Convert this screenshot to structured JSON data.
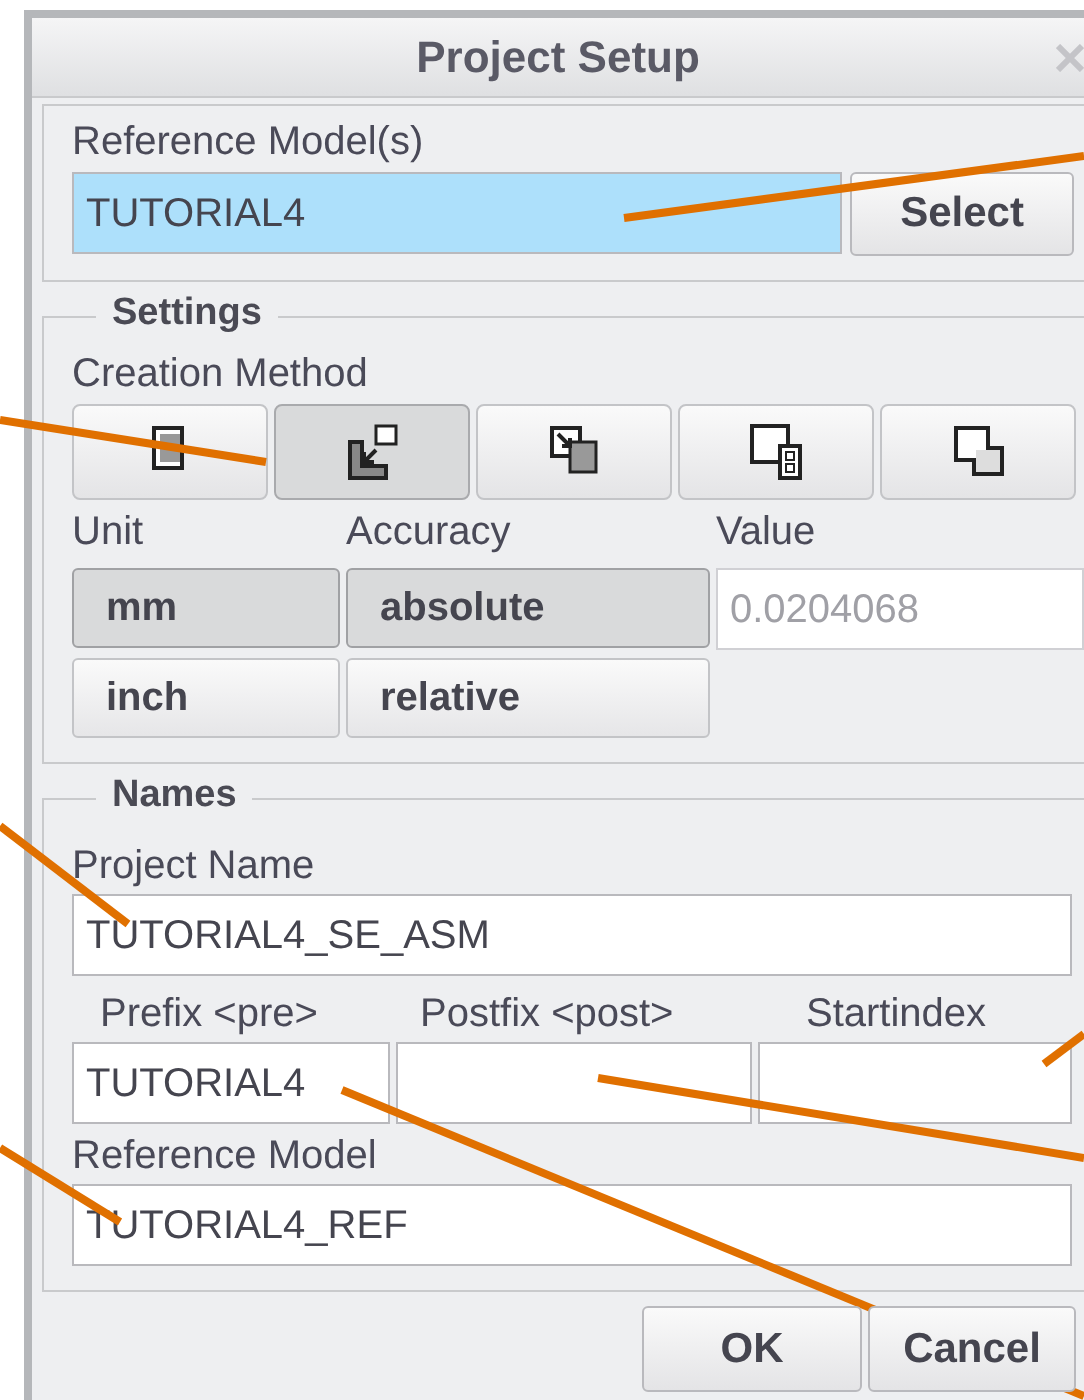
{
  "window": {
    "title": "Project Setup"
  },
  "reference_models": {
    "label": "Reference Model(s)",
    "value": "TUTORIAL4",
    "highlighted": true,
    "button": "Select"
  },
  "settings": {
    "title": "Settings",
    "creation_method": {
      "label": "Creation Method",
      "options": [
        {
          "kind": "block",
          "selected": false
        },
        {
          "kind": "corner",
          "selected": true
        },
        {
          "kind": "insert",
          "selected": false
        },
        {
          "kind": "grid",
          "selected": false
        },
        {
          "kind": "step",
          "selected": false
        }
      ]
    },
    "unit": {
      "label": "Unit",
      "options": [
        {
          "label": "mm",
          "selected": true
        },
        {
          "label": "inch",
          "selected": false
        }
      ]
    },
    "accuracy": {
      "label": "Accuracy",
      "options": [
        {
          "label": "absolute",
          "selected": true
        },
        {
          "label": "relative",
          "selected": false
        }
      ]
    },
    "value": {
      "label": "Value",
      "value": "0.0204068",
      "disabled": true
    }
  },
  "names": {
    "title": "Names",
    "project_name": {
      "label": "Project Name",
      "value": "TUTORIAL4_SE_ASM"
    },
    "prefix": {
      "label": "Prefix <pre>",
      "value": "TUTORIAL4"
    },
    "postfix": {
      "label": "Postfix <post>"
    },
    "startindex": {
      "label": "Startindex"
    },
    "reference_model": {
      "label": "Reference Model",
      "value": "TUTORIAL4_REF"
    }
  },
  "buttons": [
    "OK",
    "Cancel"
  ]
}
